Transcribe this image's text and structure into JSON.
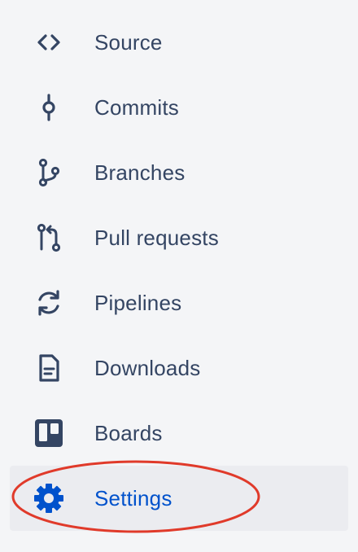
{
  "nav": {
    "items": [
      {
        "label": "Source",
        "icon": "code-icon"
      },
      {
        "label": "Commits",
        "icon": "commit-icon"
      },
      {
        "label": "Branches",
        "icon": "branch-icon"
      },
      {
        "label": "Pull requests",
        "icon": "pull-request-icon"
      },
      {
        "label": "Pipelines",
        "icon": "pipelines-icon"
      },
      {
        "label": "Downloads",
        "icon": "document-icon"
      },
      {
        "label": "Boards",
        "icon": "board-icon"
      },
      {
        "label": "Settings",
        "icon": "gear-icon",
        "selected": true
      }
    ]
  },
  "colors": {
    "background": "#f4f5f7",
    "text": "#344563",
    "selected_text": "#0052cc",
    "selected_background": "#ebecf0",
    "highlight_ring": "#e03a2a"
  }
}
